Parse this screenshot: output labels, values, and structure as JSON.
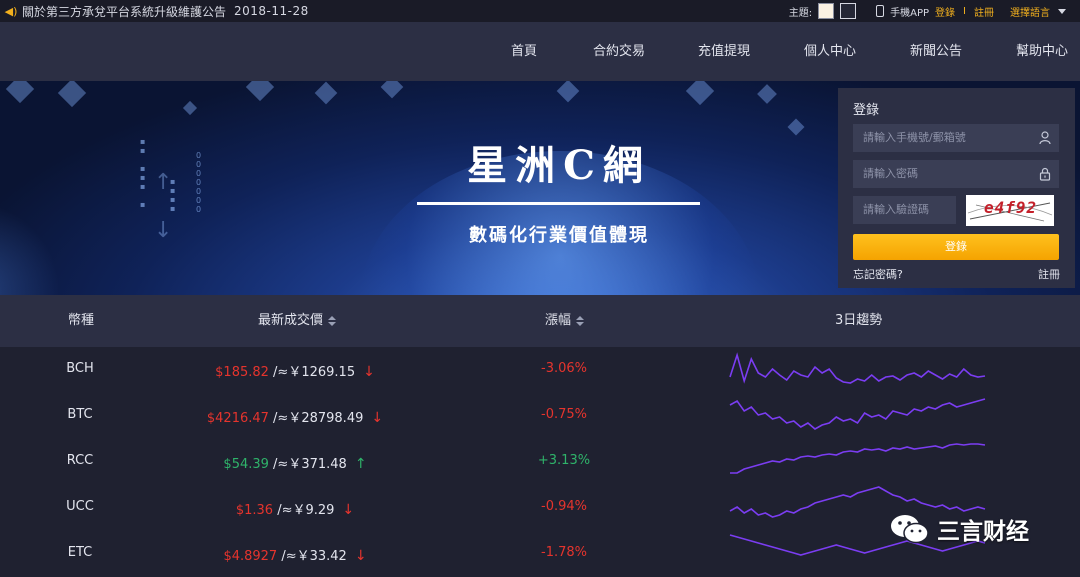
{
  "notice": {
    "text": "關於第三方承兌平台系統升級維護公告",
    "date": "2018-11-28"
  },
  "top_right": {
    "theme_label": "主題:",
    "app_label": "手機APP",
    "login": "登錄",
    "separator": "I",
    "register": "註冊",
    "language": "選擇語言"
  },
  "nav": {
    "items": [
      "首頁",
      "合約交易",
      "充值提現",
      "個人中心",
      "新聞公告",
      "幫助中心"
    ]
  },
  "hero": {
    "title": "星洲C網",
    "subtitle": "數碼化行業價值體現"
  },
  "login_panel": {
    "title": "登錄",
    "account_placeholder": "請輸入手機號/郵箱號",
    "password_placeholder": "請輸入密碼",
    "captcha_placeholder": "請輸入驗證碼",
    "captcha_text": "e4f92",
    "submit": "登錄",
    "forgot": "忘記密碼?",
    "register": "註冊"
  },
  "table": {
    "headers": {
      "coin": "幣種",
      "price": "最新成交價",
      "change": "漲幅",
      "trend": "3日趨勢"
    },
    "rows": [
      {
        "coin": "BCH",
        "usd": "$185.82",
        "cny": " /≈￥1269.15",
        "arrow": "↓",
        "change": "-3.06%",
        "direction": "down",
        "trend": [
          30,
          8,
          34,
          12,
          26,
          30,
          22,
          28,
          33,
          24,
          28,
          30,
          20,
          26,
          22,
          31,
          35,
          36,
          32,
          34,
          28,
          34,
          30,
          29,
          33,
          28,
          26,
          30,
          24,
          28,
          32,
          27,
          30,
          22,
          28,
          30,
          29
        ]
      },
      {
        "coin": "BTC",
        "usd": "$4216.47",
        "cny": " /≈￥28798.49",
        "arrow": "↓",
        "change": "-0.75%",
        "direction": "down",
        "trend": [
          12,
          8,
          18,
          14,
          22,
          20,
          26,
          24,
          30,
          28,
          34,
          30,
          36,
          32,
          30,
          24,
          28,
          26,
          30,
          20,
          24,
          22,
          26,
          18,
          20,
          22,
          16,
          18,
          14,
          16,
          12,
          10,
          14,
          12,
          10,
          8,
          6
        ]
      },
      {
        "coin": "RCC",
        "usd": "$54.39",
        "cny": " /≈￥371.48",
        "arrow": "↑",
        "change": "+3.13%",
        "direction": "up",
        "trend": [
          34,
          34,
          30,
          28,
          26,
          24,
          22,
          23,
          20,
          21,
          18,
          17,
          18,
          16,
          15,
          16,
          13,
          12,
          13,
          10,
          11,
          10,
          12,
          9,
          10,
          8,
          10,
          9,
          8,
          7,
          9,
          6,
          5,
          6,
          5,
          5,
          6
        ]
      },
      {
        "coin": "UCC",
        "usd": "$1.36",
        "cny": " /≈￥9.29",
        "arrow": "↓",
        "change": "-0.94%",
        "direction": "down",
        "trend": [
          26,
          22,
          28,
          24,
          30,
          28,
          32,
          30,
          26,
          28,
          24,
          22,
          18,
          16,
          14,
          12,
          10,
          12,
          8,
          6,
          4,
          2,
          6,
          10,
          12,
          16,
          14,
          18,
          20,
          22,
          20,
          24,
          22,
          26,
          24,
          22,
          24
        ]
      },
      {
        "coin": "ETC",
        "usd": "$4.8927",
        "cny": " /≈￥33.42",
        "arrow": "↓",
        "change": "-1.78%",
        "direction": "down",
        "trend": [
          4,
          6,
          8,
          10,
          12,
          14,
          16,
          18,
          20,
          22,
          24,
          22,
          20,
          18,
          16,
          14,
          16,
          18,
          20,
          22,
          20,
          18,
          16,
          14,
          12,
          10,
          12,
          14,
          16,
          18,
          20,
          18,
          16,
          14,
          12,
          10,
          12
        ]
      }
    ]
  },
  "watermark": {
    "text": "三言财经"
  },
  "colors": {
    "accent": "#f2b01e",
    "down": "#e5342d",
    "up": "#2fb36a",
    "trend_line": "#7b3df2"
  }
}
